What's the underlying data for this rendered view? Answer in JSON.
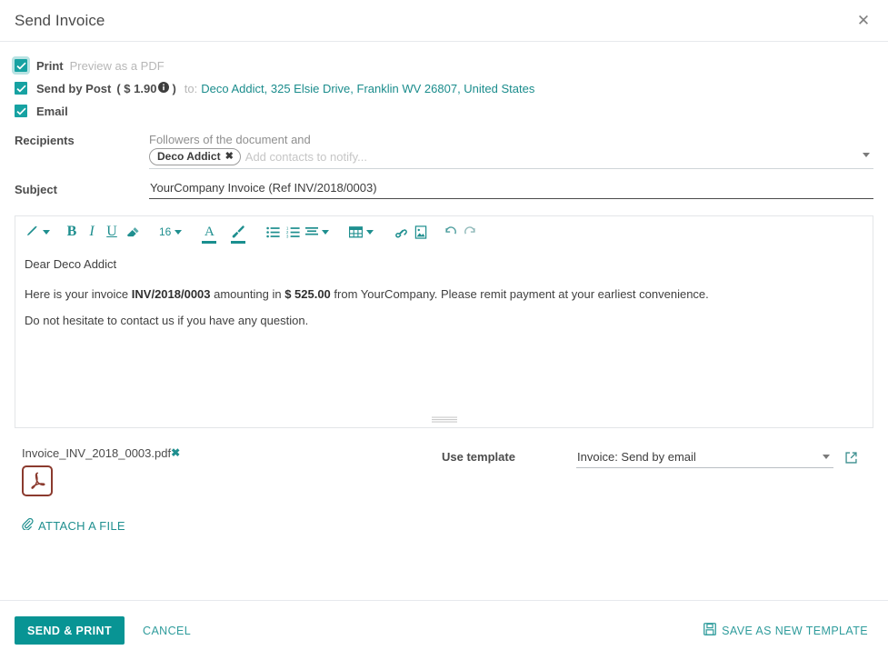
{
  "header": {
    "title": "Send Invoice",
    "close_label": "✕"
  },
  "options": [
    {
      "label": "Print",
      "sub": "Preview as a PDF",
      "checked": true
    },
    {
      "label": "Send by Post",
      "price": "( $ 1.90",
      "price_close": ")",
      "to_label": "to:",
      "address": "Deco Addict, 325 Elsie Drive, Franklin WV 26807, United States",
      "checked": true
    },
    {
      "label": "Email",
      "checked": true
    }
  ],
  "recipients": {
    "label": "Recipients",
    "followers_note": "Followers of the document and",
    "tag": "Deco Addict",
    "tag_remove": "✖",
    "placeholder": "Add contacts to notify..."
  },
  "subject": {
    "label": "Subject",
    "value": "YourCompany Invoice (Ref INV/2018/0003)"
  },
  "editor": {
    "toolbar": {
      "style_icon": "magic-wand-icon",
      "bold": "B",
      "italic": "I",
      "underline": "U",
      "eraser_icon": "eraser-icon",
      "font_size": "16",
      "font_color": "A",
      "highlight_icon": "paint-brush-icon",
      "unordered_list_icon": "unordered-list-icon",
      "ordered_list_icon": "ordered-list-icon",
      "align_icon": "align-left-icon",
      "table_icon": "table-icon",
      "link_icon": "link-icon",
      "image_icon": "image-icon",
      "undo_icon": "undo-icon",
      "redo_icon": "redo-icon"
    },
    "greeting": "Dear Deco Addict",
    "line2_part1": "Here is your invoice ",
    "line2_ref": "INV/2018/0003",
    "line2_part2": " amounting in ",
    "line2_amount": "$ 525.00",
    "line2_part3": " from YourCompany. Please remit payment at your earliest convenience.",
    "line3": "Do not hesitate to contact us if you have any question."
  },
  "attachment": {
    "filename": "Invoice_INV_2018_0003.pdf",
    "remove": "✖",
    "icon": "pdf-file-icon",
    "attach_link": "ATTACH A FILE"
  },
  "template": {
    "label": "Use template",
    "value": "Invoice: Send by email",
    "external_icon": "external-link-icon"
  },
  "footer": {
    "send_print": "SEND & PRINT",
    "cancel": "CANCEL",
    "save_template": "SAVE AS NEW TEMPLATE",
    "save_icon": "floppy-disk-icon"
  },
  "colors": {
    "accent": "#089494",
    "accent_light": "#1f8f8f",
    "link": "#1a8c8c",
    "muted": "#b7b7b7",
    "pdf_red": "#8b3a2e"
  }
}
